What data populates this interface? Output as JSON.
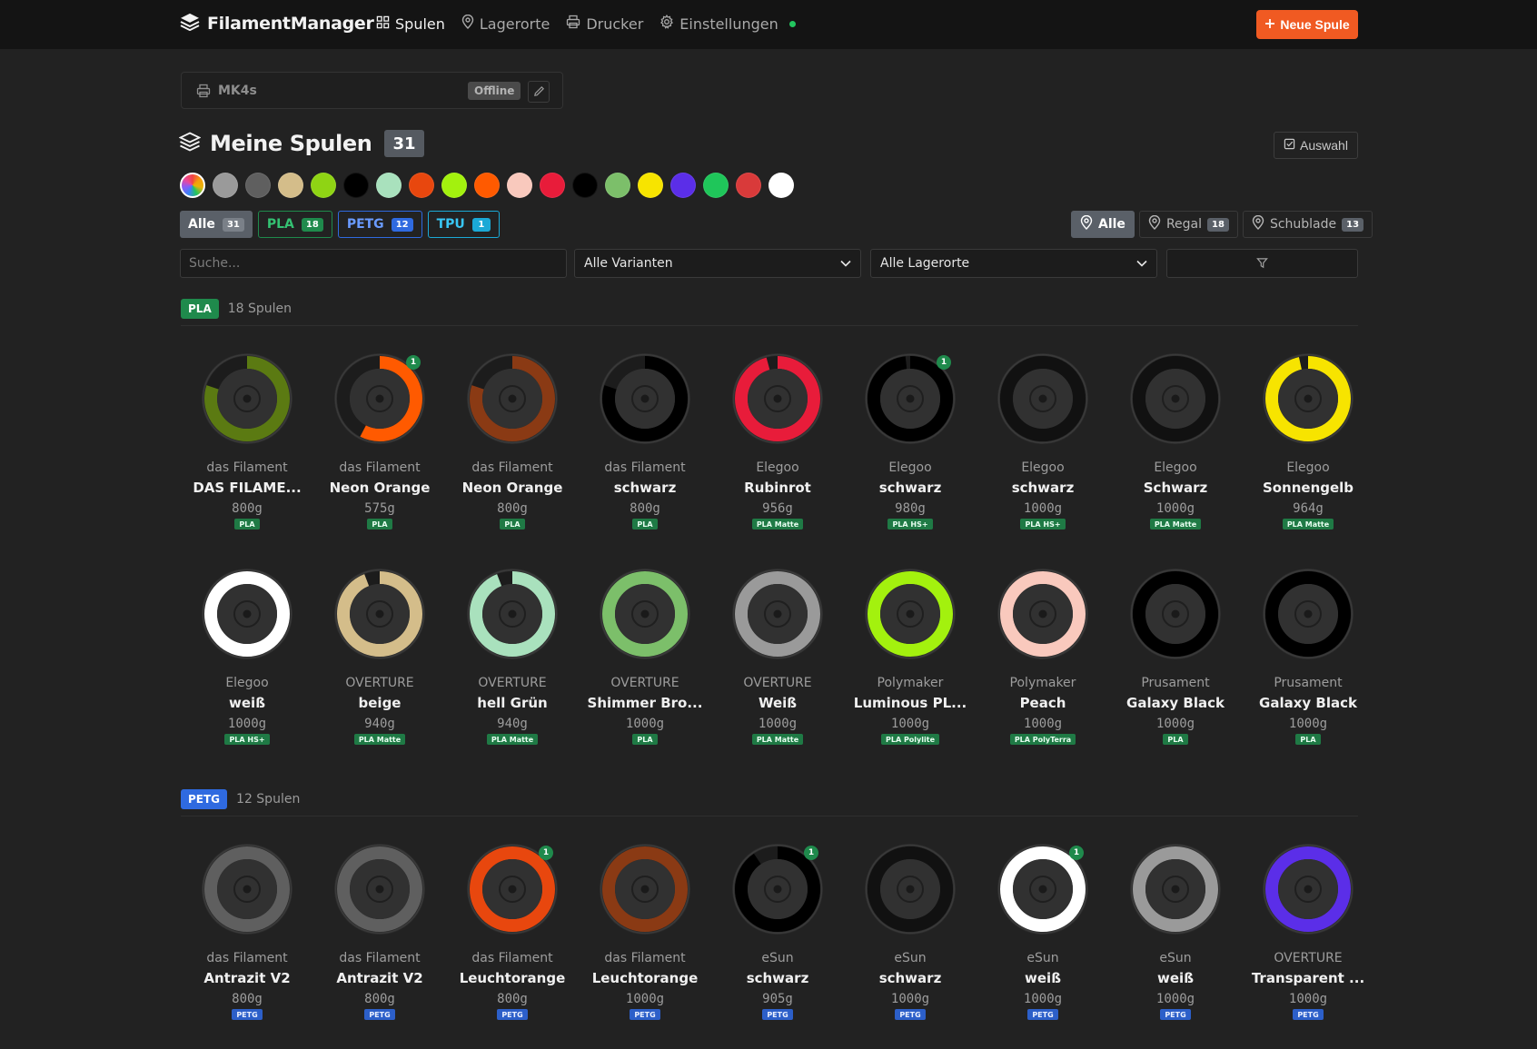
{
  "app": {
    "name": "FilamentManager",
    "nav": [
      {
        "key": "spulen",
        "label": "Spulen",
        "icon": "grid-icon",
        "active": true
      },
      {
        "key": "lagerorte",
        "label": "Lagerorte",
        "icon": "map-pin-icon",
        "active": false
      },
      {
        "key": "drucker",
        "label": "Drucker",
        "icon": "printer-icon",
        "active": false
      },
      {
        "key": "einstellungen",
        "label": "Einstellungen",
        "icon": "gear-icon",
        "active": false
      }
    ],
    "status_dot_color": "#22c55e",
    "new_button": "Neue Spule",
    "accent": "#f05a22"
  },
  "printer": {
    "name": "MK4s",
    "status": "Offline"
  },
  "header": {
    "title": "Meine Spulen",
    "count": "31",
    "select_label": "Auswahl"
  },
  "color_filters": [
    "all",
    "#9a9a9a",
    "#5f5f5f",
    "#d4bd8a",
    "#8fd414",
    "#000000",
    "#a9e1bd",
    "#e8470e",
    "#a3f10e",
    "#ff5a00",
    "#f9c9bd",
    "#e81c3a",
    "#000000",
    "#7cbf6a",
    "#f7e400",
    "#5b2ee8",
    "#1fc65a",
    "#d93a3a",
    "#ffffff"
  ],
  "type_filters": [
    {
      "label": "Alle",
      "count": "31",
      "style": "all"
    },
    {
      "label": "PLA",
      "count": "18",
      "style": "pla"
    },
    {
      "label": "PETG",
      "count": "12",
      "style": "petg"
    },
    {
      "label": "TPU",
      "count": "1",
      "style": "tpu"
    }
  ],
  "location_filters": [
    {
      "label": "Alle",
      "count": "",
      "active": true
    },
    {
      "label": "Regal",
      "count": "18",
      "active": false
    },
    {
      "label": "Schublade",
      "count": "13",
      "active": false
    }
  ],
  "search": {
    "placeholder": "Suche..."
  },
  "variant_select": "Alle Varianten",
  "location_select": "Alle Lagerorte",
  "sections": [
    {
      "badge": "PLA",
      "badge_color": "#1f8a4c",
      "count_label": "18 Spulen",
      "mat_style": "pla",
      "spools": [
        {
          "brand": "das Filament",
          "name": "DAS FILAME...",
          "weight": "800g",
          "material": "PLA",
          "color": "#5b7a12",
          "fill": 0.8,
          "qty": ""
        },
        {
          "brand": "das Filament",
          "name": "Neon Orange",
          "weight": "575g",
          "material": "PLA",
          "color": "#ff5a00",
          "fill": 0.575,
          "qty": "1"
        },
        {
          "brand": "das Filament",
          "name": "Neon Orange",
          "weight": "800g",
          "material": "PLA",
          "color": "#8a3a14",
          "fill": 0.8,
          "qty": ""
        },
        {
          "brand": "das Filament",
          "name": "schwarz",
          "weight": "800g",
          "material": "PLA",
          "color": "#000000",
          "fill": 0.8,
          "qty": ""
        },
        {
          "brand": "Elegoo",
          "name": "Rubinrot",
          "weight": "956g",
          "material": "PLA Matte",
          "color": "#e81c3a",
          "fill": 0.956,
          "qty": ""
        },
        {
          "brand": "Elegoo",
          "name": "schwarz",
          "weight": "980g",
          "material": "PLA HS+",
          "color": "#000000",
          "fill": 0.98,
          "qty": "1"
        },
        {
          "brand": "Elegoo",
          "name": "schwarz",
          "weight": "1000g",
          "material": "PLA HS+",
          "color": "#111111",
          "fill": 1,
          "qty": ""
        },
        {
          "brand": "Elegoo",
          "name": "Schwarz",
          "weight": "1000g",
          "material": "PLA Matte",
          "color": "#111111",
          "fill": 1,
          "qty": ""
        },
        {
          "brand": "Elegoo",
          "name": "Sonnengelb",
          "weight": "964g",
          "material": "PLA Matte",
          "color": "#f7e400",
          "fill": 0.964,
          "qty": ""
        },
        {
          "brand": "Elegoo",
          "name": "weiß",
          "weight": "1000g",
          "material": "PLA HS+",
          "color": "#ffffff",
          "fill": 1,
          "qty": ""
        },
        {
          "brand": "OVERTURE",
          "name": "beige",
          "weight": "940g",
          "material": "PLA Matte",
          "color": "#d4bd8a",
          "fill": 0.94,
          "qty": ""
        },
        {
          "brand": "OVERTURE",
          "name": "hell Grün",
          "weight": "940g",
          "material": "PLA Matte",
          "color": "#a9e1bd",
          "fill": 0.94,
          "qty": ""
        },
        {
          "brand": "OVERTURE",
          "name": "Shimmer Bro...",
          "weight": "1000g",
          "material": "PLA",
          "color": "#7cbf6a",
          "fill": 1,
          "qty": ""
        },
        {
          "brand": "OVERTURE",
          "name": "Weiß",
          "weight": "1000g",
          "material": "PLA Matte",
          "color": "#9a9a9a",
          "fill": 1,
          "qty": ""
        },
        {
          "brand": "Polymaker",
          "name": "Luminous PL...",
          "weight": "1000g",
          "material": "PLA Polylite",
          "color": "#a3f10e",
          "fill": 1,
          "qty": ""
        },
        {
          "brand": "Polymaker",
          "name": "Peach",
          "weight": "1000g",
          "material": "PLA PolyTerra",
          "color": "#f9c9bd",
          "fill": 1,
          "qty": ""
        },
        {
          "brand": "Prusament",
          "name": "Galaxy Black",
          "weight": "1000g",
          "material": "PLA",
          "color": "#000000",
          "fill": 1,
          "qty": ""
        },
        {
          "brand": "Prusament",
          "name": "Galaxy Black",
          "weight": "1000g",
          "material": "PLA",
          "color": "#000000",
          "fill": 1,
          "qty": ""
        }
      ]
    },
    {
      "badge": "PETG",
      "badge_color": "#2f6ae0",
      "count_label": "12 Spulen",
      "mat_style": "petg",
      "spools": [
        {
          "brand": "das Filament",
          "name": "Antrazit V2",
          "weight": "800g",
          "material": "PETG",
          "color": "#5f5f5f",
          "fill": 1,
          "qty": ""
        },
        {
          "brand": "das Filament",
          "name": "Antrazit V2",
          "weight": "800g",
          "material": "PETG",
          "color": "#5f5f5f",
          "fill": 1,
          "qty": ""
        },
        {
          "brand": "das Filament",
          "name": "Leuchtorange",
          "weight": "800g",
          "material": "PETG",
          "color": "#e8470e",
          "fill": 1,
          "qty": "1"
        },
        {
          "brand": "das Filament",
          "name": "Leuchtorange",
          "weight": "1000g",
          "material": "PETG",
          "color": "#8a3a14",
          "fill": 1,
          "qty": ""
        },
        {
          "brand": "eSun",
          "name": "schwarz",
          "weight": "905g",
          "material": "PETG",
          "color": "#000000",
          "fill": 0.905,
          "qty": "1"
        },
        {
          "brand": "eSun",
          "name": "schwarz",
          "weight": "1000g",
          "material": "PETG",
          "color": "#111111",
          "fill": 1,
          "qty": ""
        },
        {
          "brand": "eSun",
          "name": "weiß",
          "weight": "1000g",
          "material": "PETG",
          "color": "#ffffff",
          "fill": 1,
          "qty": "1"
        },
        {
          "brand": "eSun",
          "name": "weiß",
          "weight": "1000g",
          "material": "PETG",
          "color": "#9a9a9a",
          "fill": 1,
          "qty": ""
        },
        {
          "brand": "OVERTURE",
          "name": "Transparent ...",
          "weight": "1000g",
          "material": "PETG",
          "color": "#5b2ee8",
          "fill": 1,
          "qty": ""
        }
      ]
    }
  ]
}
